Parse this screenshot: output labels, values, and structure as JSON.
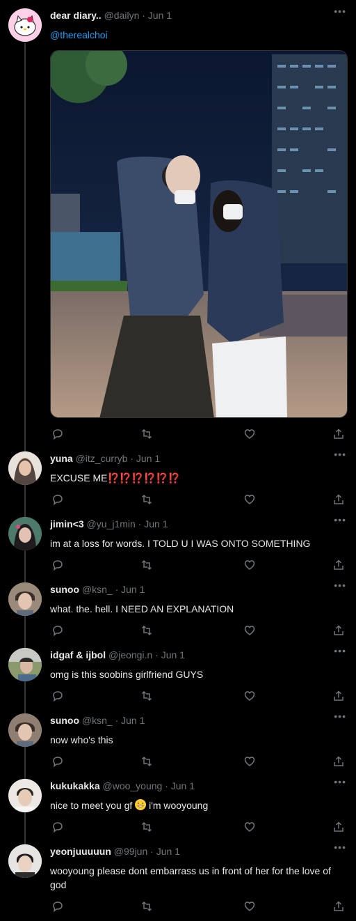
{
  "tweets": [
    {
      "name": "dear diary..",
      "handle": "@dailyn",
      "date": "· Jun 1",
      "mention": "@therealchoi",
      "text": "",
      "avatar_color": "#ffd1e8",
      "icon": "hello-kitty-avatar"
    },
    {
      "name": "yuna",
      "handle": "@itz_curryb",
      "date": "· Jun 1",
      "text": "EXCUSE ME",
      "text_suffix": "⁉️⁉️⁉️⁉️⁉️⁉️",
      "avatar_color": "#c9b2a6"
    },
    {
      "name": "jimin<3",
      "handle": "@yu_j1min",
      "date": "· Jun 1",
      "text": "im at a loss for words. I TOLD U I WAS ONTO SOMETHING",
      "avatar_color": "#3c5f63"
    },
    {
      "name": "sunoo",
      "handle": "@ksn_",
      "date": "· Jun 1",
      "text": "what. the. hell. I NEED AN EXPLANATION",
      "avatar_color": "#8a7b6e"
    },
    {
      "name": "idgaf & ijbol",
      "handle": "@jeongi.n",
      "date": "· Jun 1",
      "text": "omg is this soobins girlfriend GUYS",
      "avatar_color": "#6d7a85"
    },
    {
      "name": "sunoo",
      "handle": "@ksn_",
      "date": "· Jun 1",
      "text": "now who's this",
      "avatar_color": "#7e6f62"
    },
    {
      "name": "kukukakka",
      "handle": "@woo_young",
      "date": "· Jun 1",
      "text": "nice to meet you gf",
      "text_suffix": "i'm wooyoung",
      "avatar_color": "#cfc7c0"
    },
    {
      "name": "yeonjuuuuun",
      "handle": "@99jun",
      "date": "· Jun 1",
      "text": "wooyoung please dont embarrass us in front of her for the love of god",
      "avatar_color": "#d6d3d1"
    }
  ],
  "ui": {
    "more_label": "•••",
    "reply_icon": "reply-icon",
    "retweet_icon": "retweet-icon",
    "like_icon": "heart-icon",
    "share_icon": "share-icon"
  },
  "colors": {
    "background": "#000000",
    "text": "#e7e9ea",
    "muted": "#71767b",
    "link": "#1d9bf0"
  }
}
